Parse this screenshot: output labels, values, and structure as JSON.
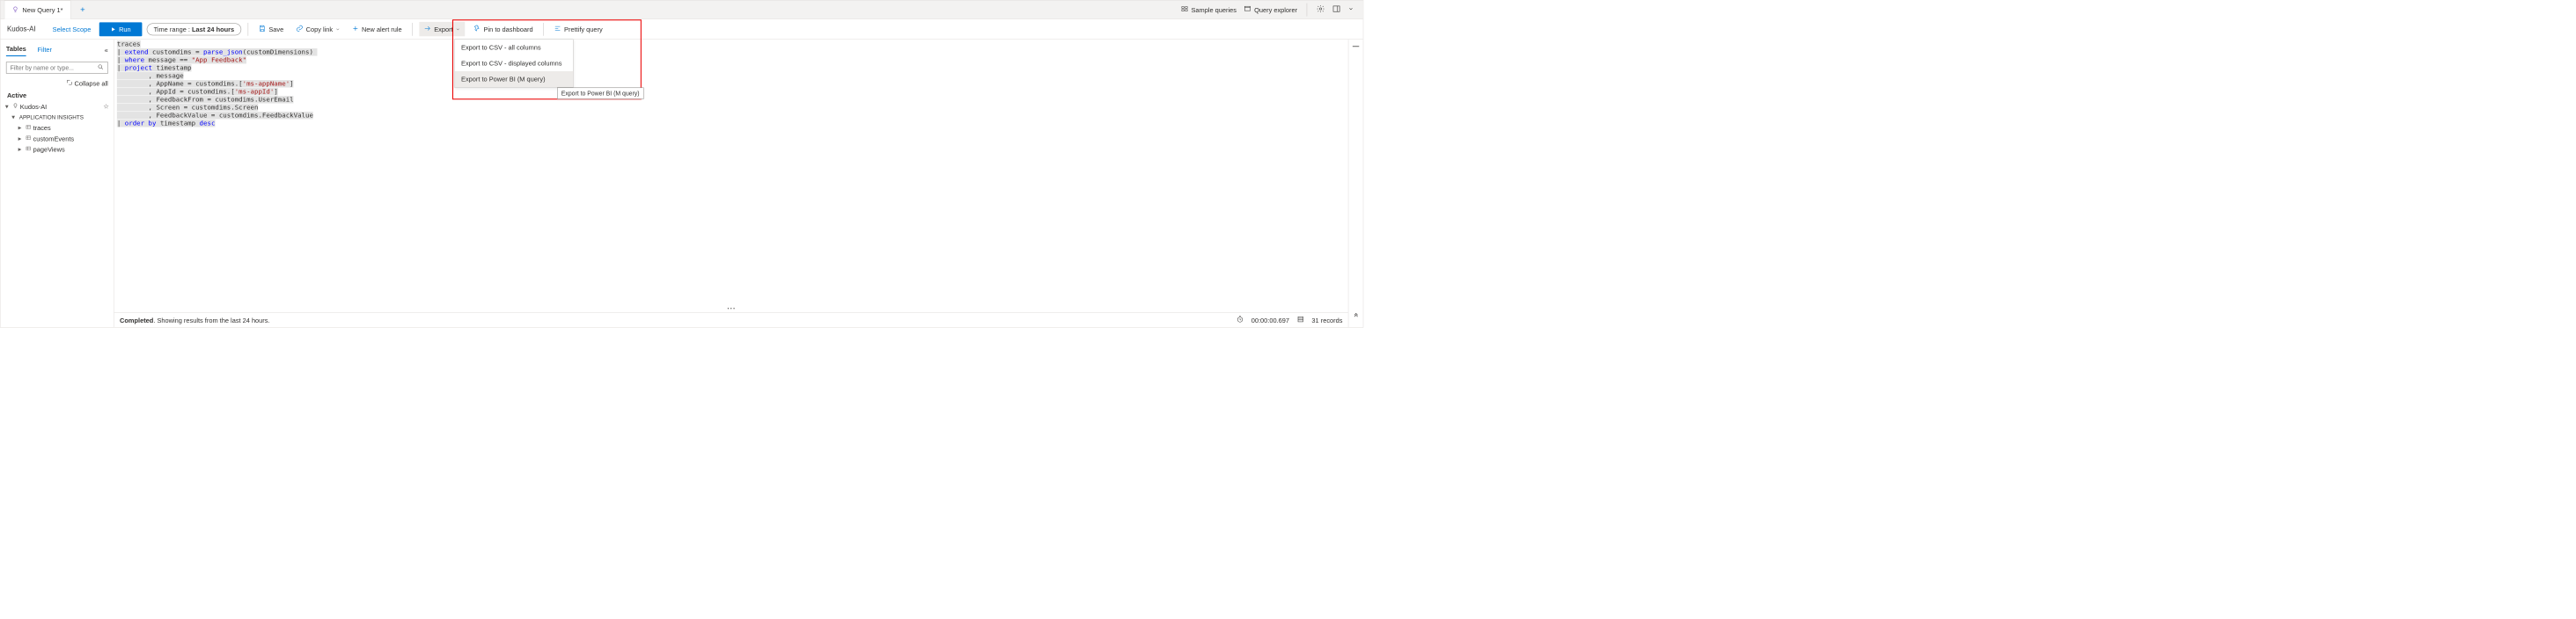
{
  "tab": {
    "title": "New Query 1*"
  },
  "header_links": {
    "sample": "Sample queries",
    "explorer": "Query explorer"
  },
  "scope": {
    "name": "Kudos-AI",
    "select": "Select Scope"
  },
  "toolbar": {
    "run": "Run",
    "timerange_prefix": "Time range : ",
    "timerange_value": "Last 24 hours",
    "save": "Save",
    "copy": "Copy link",
    "newalert": "New alert rule",
    "export": "Export",
    "pin": "Pin to dashboard",
    "prettify": "Prettify query"
  },
  "export_menu": {
    "csv_all": "Export to CSV - all columns",
    "csv_disp": "Export to CSV - displayed columns",
    "powerbi": "Export to Power BI (M query)"
  },
  "tooltip": "Export to Power BI (M query)",
  "sidebar": {
    "tabs": {
      "tables": "Tables",
      "filter": "Filter"
    },
    "search_placeholder": "Filter by name or type...",
    "collapse_all": "Collapse all",
    "active": "Active",
    "root": "Kudos-AI",
    "group": "APPLICATION INSIGHTS",
    "items": [
      "traces",
      "customEvents",
      "pageViews"
    ]
  },
  "code": {
    "lines": [
      "traces",
      "| extend customdims = parse_json(customDimensions) ",
      "| where message == \"App Feedback\"",
      "| project timestamp",
      "        , message",
      "        , AppName = customdims.['ms-appName']",
      "        , AppId = customdims.['ms-appId']",
      "        , FeedbackFrom = customdims.UserEmail",
      "        , Screen = customdims.Screen",
      "        , FeedbackValue = customdims.FeedbackValue",
      "| order by timestamp desc"
    ]
  },
  "status": {
    "completed": "Completed",
    "text": ". Showing results from the last 24 hours.",
    "duration": "00:00:00.697",
    "records": "31 records"
  }
}
